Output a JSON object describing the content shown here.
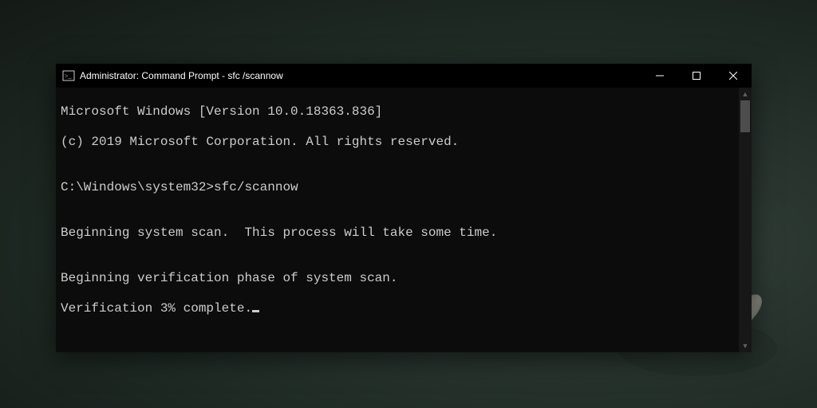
{
  "window": {
    "title": "Administrator: Command Prompt - sfc /scannow"
  },
  "terminal": {
    "line1": "Microsoft Windows [Version 10.0.18363.836]",
    "line2": "(c) 2019 Microsoft Corporation. All rights reserved.",
    "blank1": "",
    "prompt": "C:\\Windows\\system32>",
    "command": "sfc/scannow",
    "blank2": "",
    "line3": "Beginning system scan.  This process will take some time.",
    "blank3": "",
    "line4": "Beginning verification phase of system scan.",
    "line5": "Verification 3% complete."
  }
}
